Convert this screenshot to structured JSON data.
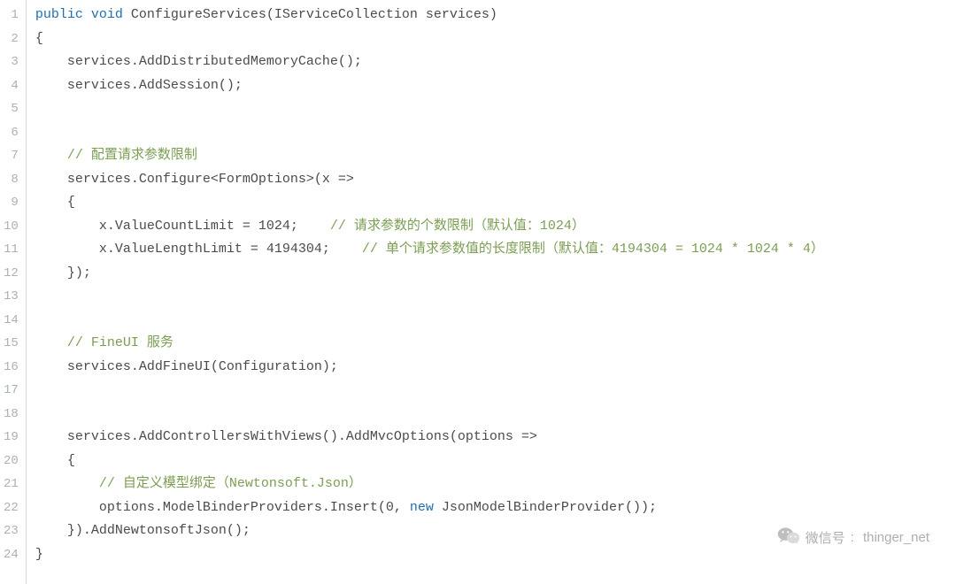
{
  "lines": [
    "public void ConfigureServices(IServiceCollection services)",
    "{",
    "    services.AddDistributedMemoryCache();",
    "    services.AddSession();",
    "",
    "",
    "    // 配置请求参数限制",
    "    services.Configure<FormOptions>(x =>",
    "    {",
    "        x.ValueCountLimit = 1024;    // 请求参数的个数限制（默认值：1024）",
    "        x.ValueLengthLimit = 4194304;    // 单个请求参数值的长度限制（默认值：4194304 = 1024 * 1024 * 4）",
    "    });",
    "",
    "",
    "    // FineUI 服务",
    "    services.AddFineUI(Configuration);",
    "",
    "",
    "    services.AddControllersWithViews().AddMvcOptions(options =>",
    "    {",
    "        // 自定义模型绑定（Newtonsoft.Json）",
    "        options.ModelBinderProviders.Insert(0, new JsonModelBinderProvider());",
    "    }).AddNewtonsoftJson();",
    "}"
  ],
  "watermark": {
    "label": "微信号",
    "handle": "thinger_net"
  }
}
